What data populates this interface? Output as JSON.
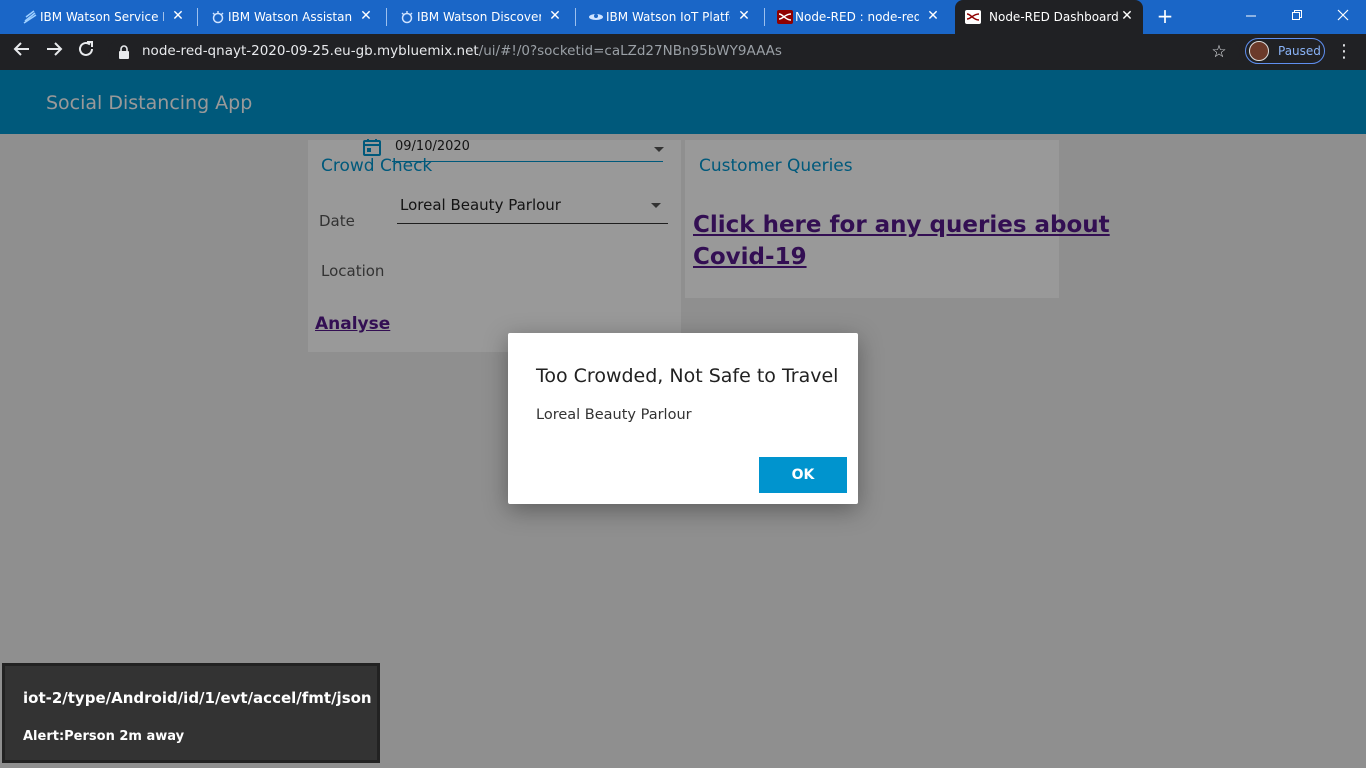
{
  "browser": {
    "tabs": [
      {
        "title": "IBM Watson Service Pac",
        "icon": "ibm-logo-icon"
      },
      {
        "title": "IBM Watson Assistant",
        "icon": "watson-icon"
      },
      {
        "title": "IBM Watson Discovery",
        "icon": "watson-icon"
      },
      {
        "title": "IBM Watson IoT Platforn",
        "icon": "iot-icon"
      },
      {
        "title": "Node-RED : node-red-q",
        "icon": "node-red-icon"
      },
      {
        "title": "Node-RED Dashboard",
        "icon": "node-red-icon",
        "active": true
      }
    ],
    "url_host": "node-red-qnayt-2020-09-25.eu-gb.mybluemix.net",
    "url_path": "/ui/#!/0?socketid=caLZd27NBn95bWY9AAAs",
    "profile_label": "Paused"
  },
  "app": {
    "title": "Social Distancing App",
    "accent_color": "#0094ce"
  },
  "crowd_check": {
    "title": "Crowd Check",
    "date_label": "Date",
    "date_value": "09/10/2020",
    "location_label": "Location",
    "location_value": "Loreal Beauty Parlour",
    "analyse_label": "Analyse"
  },
  "customer_queries": {
    "title": "Customer Queries",
    "link_line1": "Click here for any queries about",
    "link_line2": "Covid-19"
  },
  "dialog": {
    "title": "Too Crowded, Not Safe to Travel",
    "body": "Loreal Beauty Parlour",
    "ok_label": "OK"
  },
  "toast": {
    "title": "iot-2/type/Android/id/1/evt/accel/fmt/json",
    "message": "Alert:Person 2m away"
  }
}
